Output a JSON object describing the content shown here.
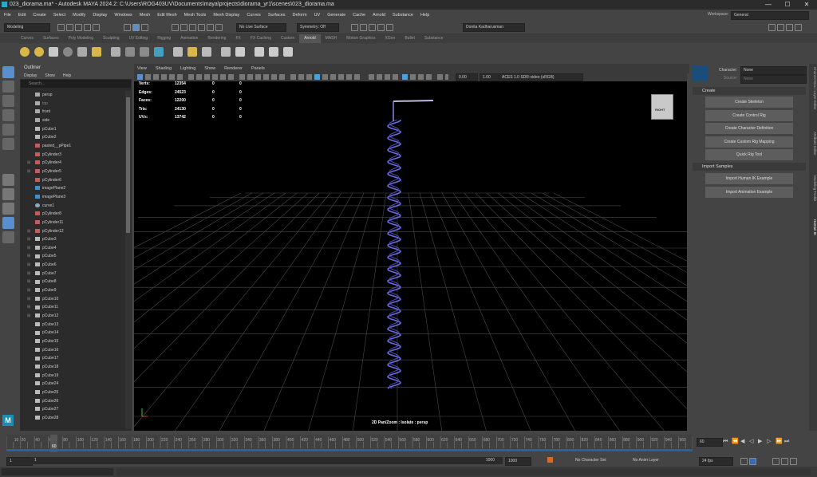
{
  "window": {
    "title": "023_diorama.ma* - Autodesk MAYA 2024.2: C:\\Users\\ROG403UV\\Documents\\maya\\projects\\diorama_yr1\\scenes\\023_diorama.ma",
    "minimize": "—",
    "maximize": "☐",
    "close": "✕"
  },
  "menu": [
    "File",
    "Edit",
    "Create",
    "Select",
    "Modify",
    "Display",
    "Windows",
    "Mesh",
    "Edit Mesh",
    "Mesh Tools",
    "Mesh Display",
    "Curves",
    "Surfaces",
    "Deform",
    "UV",
    "Generate",
    "Cache",
    "Arnold",
    "Substance",
    "Help"
  ],
  "workspace": {
    "label": "Workspace:",
    "value": "General"
  },
  "status": {
    "mode": "Modeling",
    "live_surface": "No Live Surface",
    "symmetry": "Symmetry: Off",
    "user": "Donita Kadharusman"
  },
  "shelf_tabs": [
    "Curves",
    "Surfaces",
    "Poly Modeling",
    "Sculpting",
    "UV Editing",
    "Rigging",
    "Animation",
    "Rendering",
    "FX",
    "FX Caching",
    "Custom",
    "Arnold",
    "MASH",
    "Motion Graphics",
    "XGen",
    "Bullet",
    "Substance"
  ],
  "shelf_active": "Arnold",
  "outliner": {
    "title": "Outliner",
    "menu": [
      "Display",
      "Show",
      "Help"
    ],
    "search_placeholder": "Search...",
    "items": [
      "persp",
      "top",
      "front",
      "side",
      "pCube1",
      "pCube2",
      "pasted__pPipe1",
      "pCylinder3",
      "pCylinder4",
      "pCylinder5",
      "pCylinder6",
      "imagePlane2",
      "imagePlane3",
      "curve1",
      "pCylinder8",
      "pCylinder11",
      "pCylinder12",
      "pCube3",
      "pCube4",
      "pCube5",
      "pCube6",
      "pCube7",
      "pCube8",
      "pCube9",
      "pCube10",
      "pCube11",
      "pCube12",
      "pCube13",
      "pCube14",
      "pCube15",
      "pCube16",
      "pCube17",
      "pCube18",
      "pCube19",
      "pCube24",
      "pCube25",
      "pCube26",
      "pCube27",
      "pCube28"
    ]
  },
  "viewport": {
    "menu": [
      "View",
      "Shading",
      "Lighting",
      "Show",
      "Renderer",
      "Panels"
    ],
    "exposure": "0.00",
    "gamma": "1.00",
    "colorspace": "ACES 1.0 SDR-video (sRGB)",
    "hud": [
      {
        "label": "Verts:",
        "v1": "12354",
        "v2": "0",
        "v3": "0"
      },
      {
        "label": "Edges:",
        "v1": "24523",
        "v2": "0",
        "v3": "0"
      },
      {
        "label": "Faces:",
        "v1": "12200",
        "v2": "0",
        "v3": "0"
      },
      {
        "label": "Tris:",
        "v1": "24130",
        "v2": "0",
        "v3": "0"
      },
      {
        "label": "UVs:",
        "v1": "13742",
        "v2": "0",
        "v3": "0"
      }
    ],
    "viewcube_label": "RIGHT",
    "camera_label": "2D Pan/Zoom : Isolate : persp"
  },
  "hik": {
    "character_label": "Character:",
    "character_value": "None",
    "source_label": "Source:",
    "source_value": "None",
    "create_section": "Create",
    "create_buttons": [
      "Create Skeleton",
      "Create Control Rig",
      "Create Character Definition",
      "Create Custom Rig Mapping",
      "Quick Rig Tool"
    ],
    "import_section": "Import Samples",
    "import_buttons": [
      "Import Human IK Example",
      "Import Animation Example"
    ]
  },
  "side_tabs": [
    "Channel Box / Layer Editor",
    "Attribute Editor",
    "Modeling Toolkit",
    "Human IK"
  ],
  "timeline": {
    "ticks": [
      "10",
      "20",
      "40",
      "60",
      "80",
      "100",
      "120",
      "140",
      "160",
      "180",
      "200",
      "220",
      "240",
      "260",
      "280",
      "300",
      "320",
      "340",
      "360",
      "380",
      "400",
      "420",
      "440",
      "460",
      "480",
      "500",
      "520",
      "540",
      "560",
      "580",
      "600",
      "620",
      "640",
      "660",
      "680",
      "700",
      "720",
      "740",
      "760",
      "780",
      "800",
      "820",
      "840",
      "860",
      "880",
      "900",
      "920",
      "940",
      "960"
    ],
    "current_frame_label": "60",
    "current_frame": "60"
  },
  "range": {
    "start": "1",
    "start2": "1",
    "end": "1000",
    "end2": "1000",
    "character_set": "No Character Set",
    "anim_layer": "No Anim Layer",
    "fps": "24 fps"
  }
}
